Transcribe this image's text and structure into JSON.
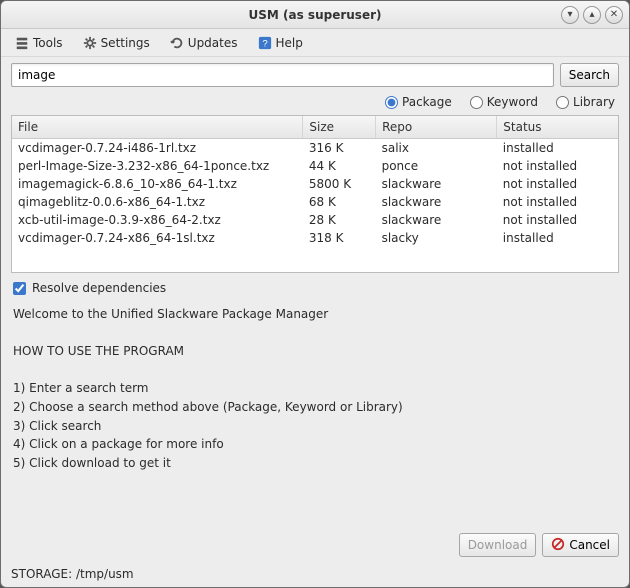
{
  "window": {
    "title": "USM (as superuser)"
  },
  "menubar": {
    "tools": "Tools",
    "settings": "Settings",
    "updates": "Updates",
    "help": "Help"
  },
  "search": {
    "value": "image",
    "button": "Search"
  },
  "mode": {
    "package": "Package",
    "keyword": "Keyword",
    "library": "Library",
    "selected": "package"
  },
  "table": {
    "headers": {
      "file": "File",
      "size": "Size",
      "repo": "Repo",
      "status": "Status"
    },
    "rows": [
      {
        "file": "vcdimager-0.7.24-i486-1rl.txz",
        "size": "316 K",
        "repo": "salix",
        "status": "installed"
      },
      {
        "file": "perl-Image-Size-3.232-x86_64-1ponce.txz",
        "size": "44 K",
        "repo": "ponce",
        "status": "not installed"
      },
      {
        "file": "imagemagick-6.8.6_10-x86_64-1.txz",
        "size": "5800 K",
        "repo": "slackware",
        "status": "not installed"
      },
      {
        "file": "qimageblitz-0.0.6-x86_64-1.txz",
        "size": "68 K",
        "repo": "slackware",
        "status": "not installed"
      },
      {
        "file": "xcb-util-image-0.3.9-x86_64-2.txz",
        "size": "28 K",
        "repo": "slackware",
        "status": "not installed"
      },
      {
        "file": "vcdimager-0.7.24-x86_64-1sl.txz",
        "size": "318 K",
        "repo": "slacky",
        "status": "installed"
      }
    ]
  },
  "resolve": {
    "label": "Resolve dependencies",
    "checked": true
  },
  "help_text": "Welcome to the Unified Slackware Package Manager\n\nHOW TO USE THE PROGRAM\n\n1) Enter a search term\n2) Choose a search method above (Package, Keyword or Library)\n3) Click search\n4) Click on a package for more info\n5) Click download to get it",
  "footer": {
    "download": "Download",
    "cancel": "Cancel"
  },
  "status": "STORAGE: /tmp/usm"
}
